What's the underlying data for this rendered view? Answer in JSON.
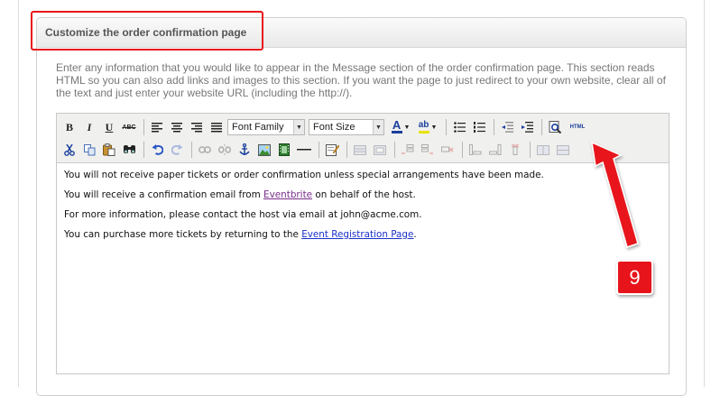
{
  "panel": {
    "title": "Customize the order confirmation page",
    "description": "Enter any information that you would like to appear in the Message section of the order confirmation page. This section reads HTML so you can also add links and images to this section. If you want the page to just redirect to your own website, clear all of the text and just enter your website URL (including the http://)."
  },
  "toolbar": {
    "bold": "B",
    "italic": "I",
    "underline": "U",
    "strikethrough": "ABC",
    "font_family": "Font Family",
    "font_size": "Font Size",
    "font_color": "A",
    "highlight": "ab",
    "html": "HTML",
    "icons_row1": [
      "bold-icon",
      "italic-icon",
      "underline-icon",
      "strikethrough-icon",
      "align-left-icon",
      "align-center-icon",
      "align-right-icon",
      "align-justify-icon",
      "font-family-select",
      "font-size-select",
      "text-color-icon",
      "highlight-color-icon",
      "bullet-list-icon",
      "numbered-list-icon",
      "outdent-icon",
      "indent-icon",
      "preview-icon",
      "html-source-icon"
    ],
    "icons_row2": [
      "cut-icon",
      "copy-icon",
      "paste-icon",
      "find-icon",
      "undo-icon",
      "redo-icon",
      "link-icon",
      "unlink-icon",
      "anchor-icon",
      "image-icon",
      "media-icon",
      "horizontal-rule-icon",
      "edit-icon",
      "table-icon",
      "table-props-icon",
      "insert-row-before-icon",
      "insert-row-after-icon",
      "delete-row-icon",
      "insert-col-before-icon",
      "insert-col-after-icon",
      "delete-col-icon",
      "merge-cells-icon",
      "split-cells-icon"
    ]
  },
  "content": {
    "line1": "You will not receive paper tickets or order confirmation unless special arrangements have been made.",
    "line2_pre": "You will receive a confirmation email from ",
    "line2_link": "Eventbrite",
    "line2_post": " on behalf of the host.",
    "line3": "For more information, please contact the host via email at john@acme.com.",
    "line4_pre": "You can purchase more tickets by returning to the ",
    "line4_link": "Event Registration Page",
    "line4_post": "."
  },
  "annotation": {
    "step_number": "9",
    "color": "#e8141b"
  }
}
